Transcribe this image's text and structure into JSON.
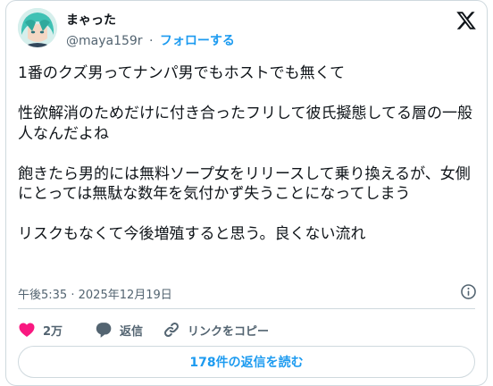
{
  "user": {
    "display_name": "まゃった",
    "handle": "@maya159r",
    "separator": "·",
    "follow_label": "フォローする"
  },
  "tweet": {
    "paragraphs": [
      "1番のクズ男ってナンパ男でもホストでも無くて",
      "性欲解消のためだけに付き合ったフリして彼氏擬態してる層の一般人なんだよね",
      "飽きたら男的には無料ソープ女をリリースして乗り換えるが、女側にとっては無駄な数年を気付かず失うことになってしまう",
      "リスクもなくて今後増殖すると思う。良くない流れ"
    ],
    "time": "午後5:35",
    "date_separator": "·",
    "date": "2025年12月19日"
  },
  "actions": {
    "like_count": "2万",
    "reply_label": "返信",
    "copy_link_label": "リンクをコピー"
  },
  "replies_button_label": "178件の返信を読む",
  "colors": {
    "accent": "#1d9bf0",
    "like": "#f91880",
    "text_secondary": "#536471",
    "border": "#cfd9de"
  },
  "icons": {
    "brand": "x-logo-icon",
    "info": "info-icon",
    "like": "heart-icon",
    "reply": "speech-bubble-icon",
    "copy_link": "link-icon"
  }
}
